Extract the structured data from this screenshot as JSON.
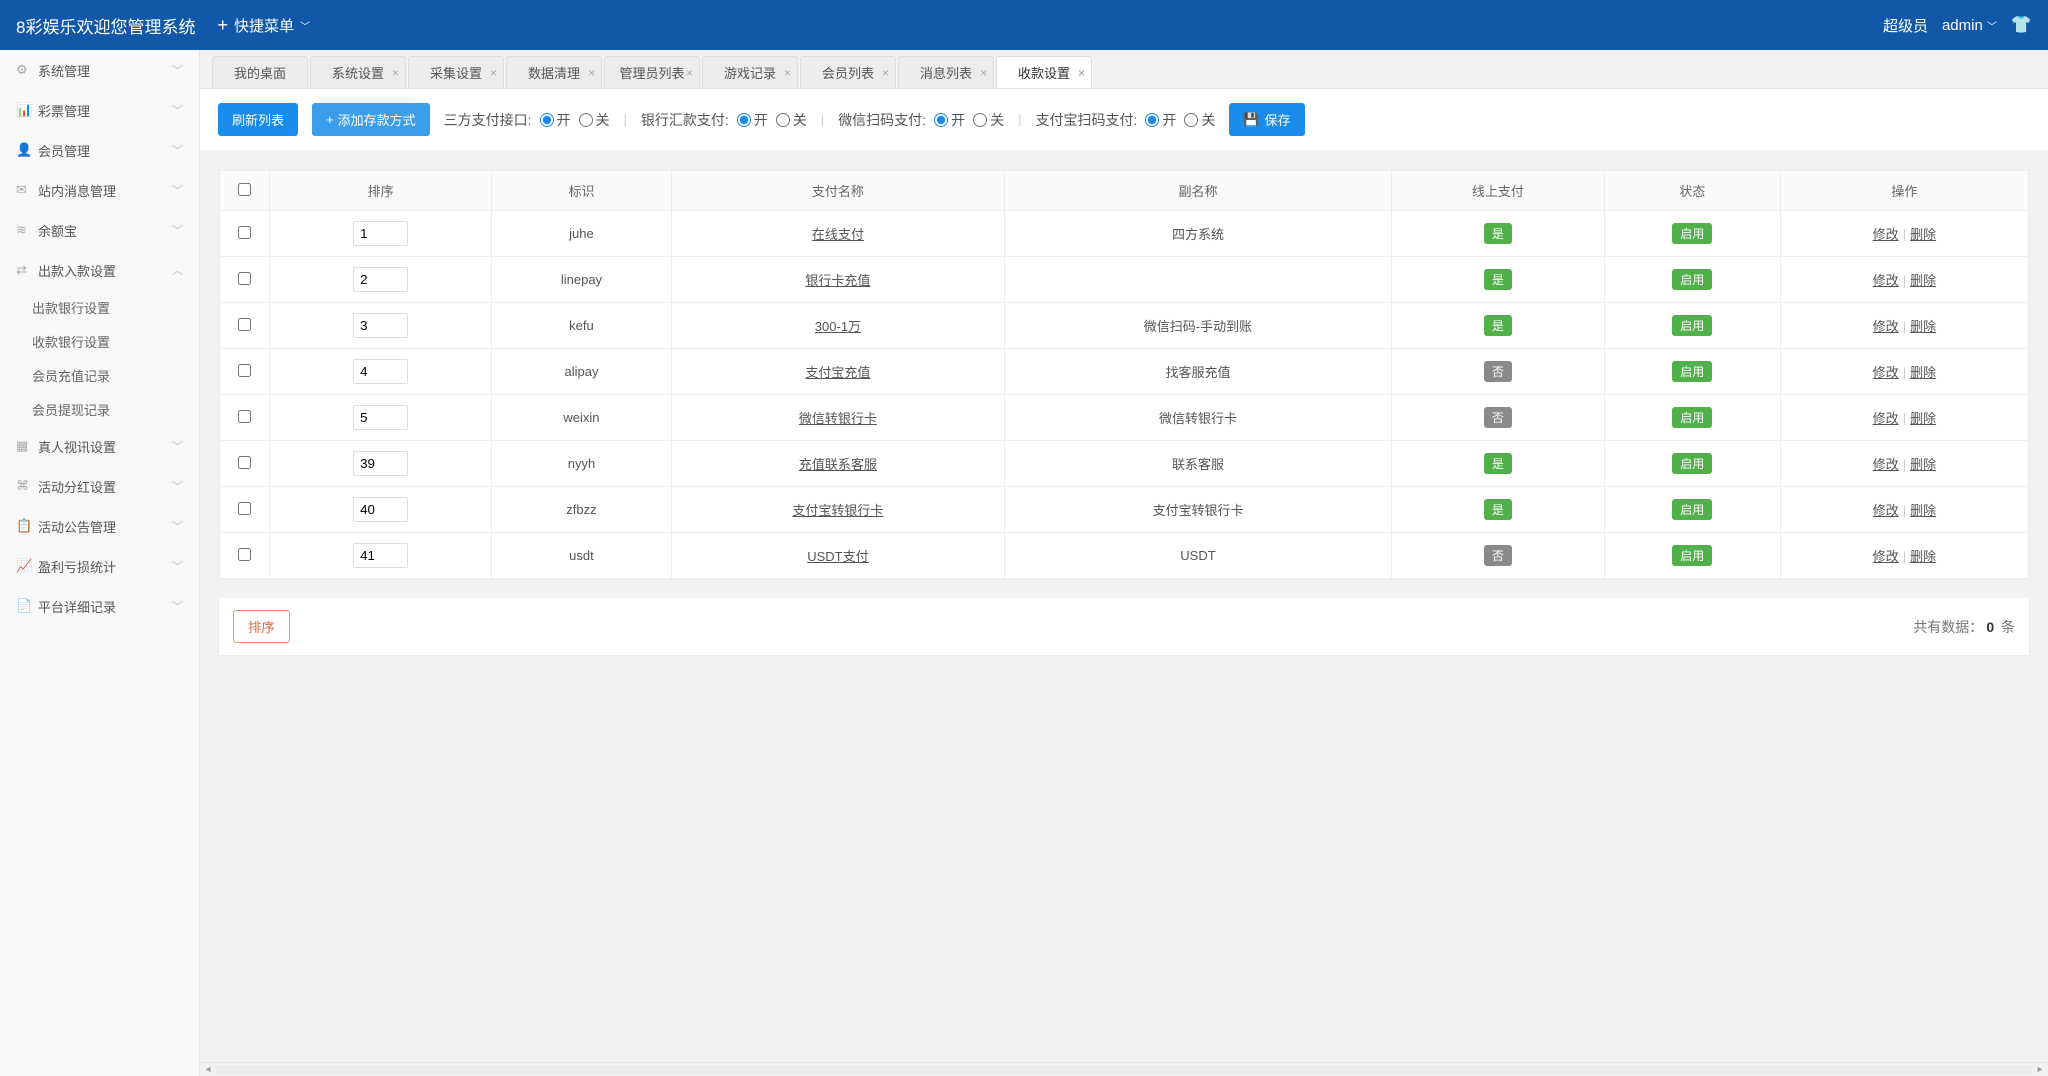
{
  "header": {
    "brand": "8彩娱乐欢迎您管理系统",
    "quickmenu": "快捷菜单",
    "role": "超级员",
    "user": "admin"
  },
  "sidebar": {
    "items": [
      {
        "icon": "⚙",
        "label": "系统管理",
        "exp": false
      },
      {
        "icon": "📊",
        "label": "彩票管理",
        "exp": false
      },
      {
        "icon": "👤",
        "label": "会员管理",
        "exp": false
      },
      {
        "icon": "✉",
        "label": "站内消息管理",
        "exp": false
      },
      {
        "icon": "≋",
        "label": "余额宝",
        "exp": false
      },
      {
        "icon": "⇄",
        "label": "出款入款设置",
        "exp": true
      },
      {
        "icon": "▦",
        "label": "真人视讯设置",
        "exp": false
      },
      {
        "icon": "⌘",
        "label": "活动分红设置",
        "exp": false
      },
      {
        "icon": "📋",
        "label": "活动公告管理",
        "exp": false
      },
      {
        "icon": "📈",
        "label": "盈利亏损统计",
        "exp": false
      },
      {
        "icon": "📄",
        "label": "平台详细记录",
        "exp": false
      }
    ],
    "sub": [
      "出款银行设置",
      "收款银行设置",
      "会员充值记录",
      "会员提现记录"
    ]
  },
  "tabs": [
    {
      "label": "我的桌面",
      "closable": false,
      "active": false
    },
    {
      "label": "系统设置",
      "closable": true,
      "active": false
    },
    {
      "label": "采集设置",
      "closable": true,
      "active": false
    },
    {
      "label": "数据清理",
      "closable": true,
      "active": false
    },
    {
      "label": "管理员列表",
      "closable": true,
      "active": false
    },
    {
      "label": "游戏记录",
      "closable": true,
      "active": false
    },
    {
      "label": "会员列表",
      "closable": true,
      "active": false
    },
    {
      "label": "消息列表",
      "closable": true,
      "active": false
    },
    {
      "label": "收款设置",
      "closable": true,
      "active": true
    }
  ],
  "toolbar": {
    "refresh": "刷新列表",
    "add": "添加存款方式",
    "save": "保存",
    "switches": [
      {
        "label": "三方支付接口:",
        "on": "开",
        "off": "关",
        "val": true
      },
      {
        "label": "银行汇款支付:",
        "on": "开",
        "off": "关",
        "val": true
      },
      {
        "label": "微信扫码支付:",
        "on": "开",
        "off": "关",
        "val": true
      },
      {
        "label": "支付宝扫码支付:",
        "on": "开",
        "off": "关",
        "val": true
      }
    ]
  },
  "table": {
    "cols": [
      "",
      "排序",
      "标识",
      "支付名称",
      "副名称",
      "线上支付",
      "状态",
      "操作"
    ],
    "yes": "是",
    "no": "否",
    "enabled": "启用",
    "ops_edit": "修改",
    "ops_del": "删除",
    "rows": [
      {
        "sort": "1",
        "ident": "juhe",
        "name": "在线支付",
        "sub": "四方系统",
        "online": true
      },
      {
        "sort": "2",
        "ident": "linepay",
        "name": "银行卡充值",
        "sub": "",
        "online": true
      },
      {
        "sort": "3",
        "ident": "kefu",
        "name": "300-1万",
        "sub": "微信扫码-手动到账",
        "online": true
      },
      {
        "sort": "4",
        "ident": "alipay",
        "name": "支付宝充值",
        "sub": "找客服充值",
        "online": false
      },
      {
        "sort": "5",
        "ident": "weixin",
        "name": "微信转银行卡",
        "sub": "微信转银行卡",
        "online": false
      },
      {
        "sort": "39",
        "ident": "nyyh",
        "name": "充值联系客服",
        "sub": "联系客服",
        "online": true
      },
      {
        "sort": "40",
        "ident": "zfbzz",
        "name": "支付宝转银行卡",
        "sub": "支付宝转银行卡",
        "online": true
      },
      {
        "sort": "41",
        "ident": "usdt",
        "name": "USDT支付",
        "sub": "USDT",
        "online": false
      }
    ]
  },
  "footer": {
    "sort_btn": "排序",
    "total_prefix": "共有数据：",
    "total_count": "0",
    "total_suffix": " 条"
  }
}
